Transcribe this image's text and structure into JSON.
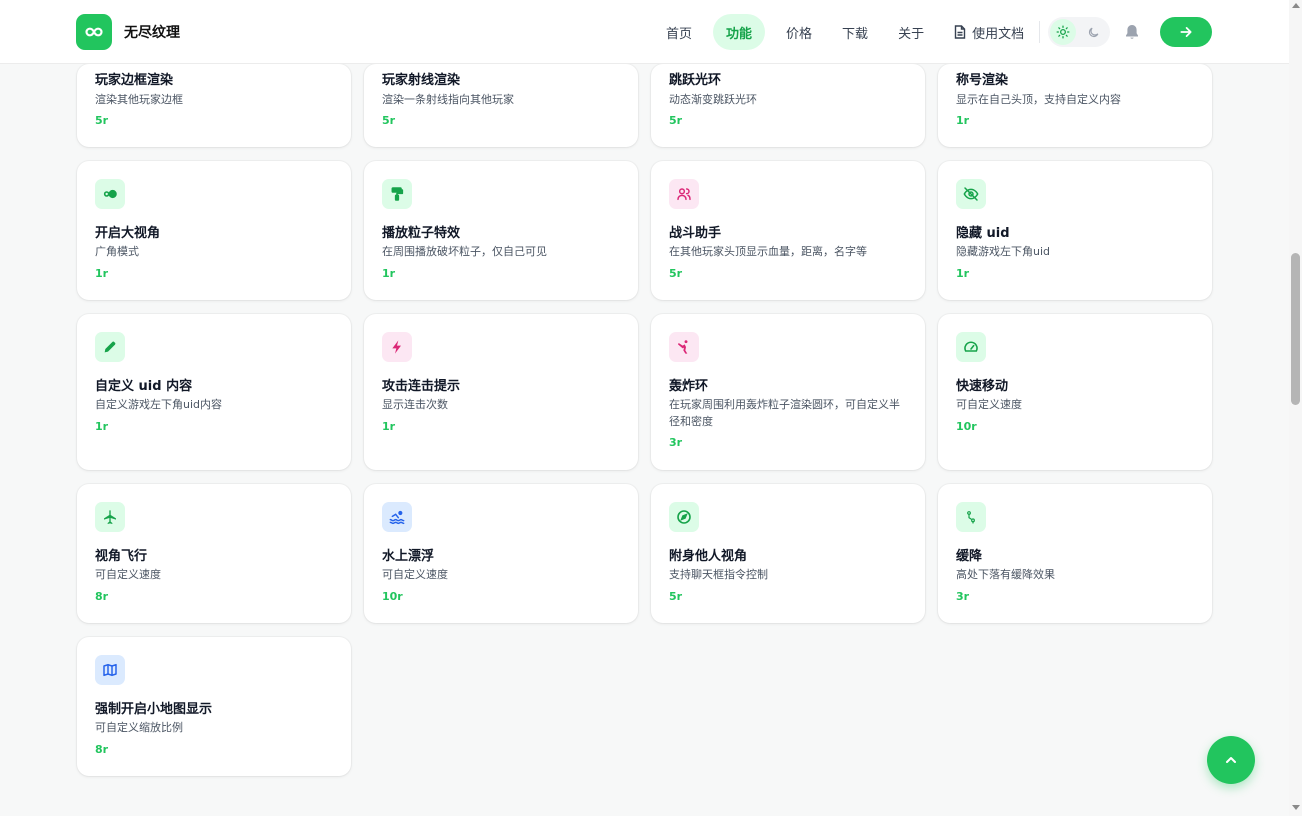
{
  "header": {
    "brand": "无尽纹理",
    "nav": [
      "首页",
      "功能",
      "价格",
      "下载",
      "关于",
      "使用文档"
    ],
    "active_nav": "功能"
  },
  "colors": {
    "accent": "#22c55e",
    "accent_light": "#dcfce7",
    "pink": "#db2777",
    "blue": "#2563eb"
  },
  "features": [
    {
      "title": "玩家边框渲染",
      "desc": "渲染其他玩家边框",
      "price": "5r"
    },
    {
      "title": "玩家射线渲染",
      "desc": "渲染一条射线指向其他玩家",
      "price": "5r"
    },
    {
      "title": "跳跃光环",
      "desc": "动态渐变跳跃光环",
      "price": "5r"
    },
    {
      "title": "称号渲染",
      "desc": "显示在自己头顶，支持自定义内容",
      "price": "1r"
    },
    {
      "title": "开启大视角",
      "desc": "广角模式",
      "price": "1r",
      "icon": "toggle-icon"
    },
    {
      "title": "播放粒子特效",
      "desc": "在周围播放破坏粒子，仅自己可见",
      "price": "1r",
      "icon": "paint-roller-icon"
    },
    {
      "title": "战斗助手",
      "desc": "在其他玩家头顶显示血量，距离，名字等",
      "price": "5r",
      "icon": "users-icon"
    },
    {
      "title": "隐藏 uid",
      "desc": "隐藏游戏左下角uid",
      "price": "1r",
      "icon": "eye-off-icon"
    },
    {
      "title": "自定义 uid 内容",
      "desc": "自定义游戏左下角uid内容",
      "price": "1r",
      "icon": "pencil-icon"
    },
    {
      "title": "攻击连击提示",
      "desc": "显示连击次数",
      "price": "1r",
      "icon": "zap-icon"
    },
    {
      "title": "轰炸环",
      "desc": "在玩家周围利用轰炸粒子渲染圆环，可自定义半径和密度",
      "price": "3r",
      "icon": "karate-icon"
    },
    {
      "title": "快速移动",
      "desc": "可自定义速度",
      "price": "10r",
      "icon": "gauge-icon"
    },
    {
      "title": "视角飞行",
      "desc": "可自定义速度",
      "price": "8r",
      "icon": "plane-icon"
    },
    {
      "title": "水上漂浮",
      "desc": "可自定义速度",
      "price": "10r",
      "icon": "swimmer-icon"
    },
    {
      "title": "附身他人视角",
      "desc": "支持聊天框指令控制",
      "price": "5r",
      "icon": "compass-icon"
    },
    {
      "title": "缓降",
      "desc": "高处下落有缓降效果",
      "price": "3r",
      "icon": "feather-fall-icon"
    },
    {
      "title": "强制开启小地图显示",
      "desc": "可自定义缩放比例",
      "price": "8r",
      "icon": "map-icon"
    }
  ]
}
